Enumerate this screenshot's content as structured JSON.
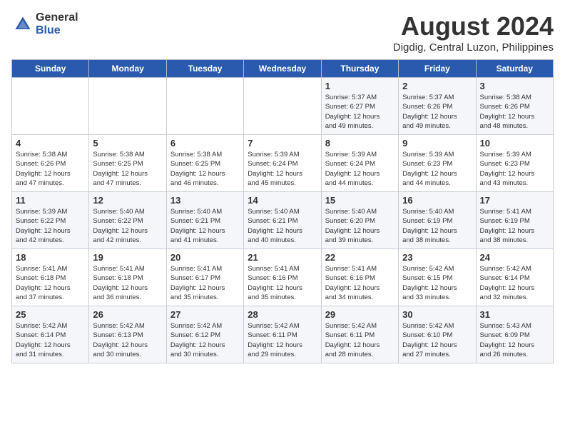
{
  "header": {
    "logo_general": "General",
    "logo_blue": "Blue",
    "month_year": "August 2024",
    "location": "Digdig, Central Luzon, Philippines"
  },
  "days_of_week": [
    "Sunday",
    "Monday",
    "Tuesday",
    "Wednesday",
    "Thursday",
    "Friday",
    "Saturday"
  ],
  "weeks": [
    [
      {
        "day": "",
        "info": ""
      },
      {
        "day": "",
        "info": ""
      },
      {
        "day": "",
        "info": ""
      },
      {
        "day": "",
        "info": ""
      },
      {
        "day": "1",
        "info": "Sunrise: 5:37 AM\nSunset: 6:27 PM\nDaylight: 12 hours\nand 49 minutes."
      },
      {
        "day": "2",
        "info": "Sunrise: 5:37 AM\nSunset: 6:26 PM\nDaylight: 12 hours\nand 49 minutes."
      },
      {
        "day": "3",
        "info": "Sunrise: 5:38 AM\nSunset: 6:26 PM\nDaylight: 12 hours\nand 48 minutes."
      }
    ],
    [
      {
        "day": "4",
        "info": "Sunrise: 5:38 AM\nSunset: 6:26 PM\nDaylight: 12 hours\nand 47 minutes."
      },
      {
        "day": "5",
        "info": "Sunrise: 5:38 AM\nSunset: 6:25 PM\nDaylight: 12 hours\nand 47 minutes."
      },
      {
        "day": "6",
        "info": "Sunrise: 5:38 AM\nSunset: 6:25 PM\nDaylight: 12 hours\nand 46 minutes."
      },
      {
        "day": "7",
        "info": "Sunrise: 5:39 AM\nSunset: 6:24 PM\nDaylight: 12 hours\nand 45 minutes."
      },
      {
        "day": "8",
        "info": "Sunrise: 5:39 AM\nSunset: 6:24 PM\nDaylight: 12 hours\nand 44 minutes."
      },
      {
        "day": "9",
        "info": "Sunrise: 5:39 AM\nSunset: 6:23 PM\nDaylight: 12 hours\nand 44 minutes."
      },
      {
        "day": "10",
        "info": "Sunrise: 5:39 AM\nSunset: 6:23 PM\nDaylight: 12 hours\nand 43 minutes."
      }
    ],
    [
      {
        "day": "11",
        "info": "Sunrise: 5:39 AM\nSunset: 6:22 PM\nDaylight: 12 hours\nand 42 minutes."
      },
      {
        "day": "12",
        "info": "Sunrise: 5:40 AM\nSunset: 6:22 PM\nDaylight: 12 hours\nand 42 minutes."
      },
      {
        "day": "13",
        "info": "Sunrise: 5:40 AM\nSunset: 6:21 PM\nDaylight: 12 hours\nand 41 minutes."
      },
      {
        "day": "14",
        "info": "Sunrise: 5:40 AM\nSunset: 6:21 PM\nDaylight: 12 hours\nand 40 minutes."
      },
      {
        "day": "15",
        "info": "Sunrise: 5:40 AM\nSunset: 6:20 PM\nDaylight: 12 hours\nand 39 minutes."
      },
      {
        "day": "16",
        "info": "Sunrise: 5:40 AM\nSunset: 6:19 PM\nDaylight: 12 hours\nand 38 minutes."
      },
      {
        "day": "17",
        "info": "Sunrise: 5:41 AM\nSunset: 6:19 PM\nDaylight: 12 hours\nand 38 minutes."
      }
    ],
    [
      {
        "day": "18",
        "info": "Sunrise: 5:41 AM\nSunset: 6:18 PM\nDaylight: 12 hours\nand 37 minutes."
      },
      {
        "day": "19",
        "info": "Sunrise: 5:41 AM\nSunset: 6:18 PM\nDaylight: 12 hours\nand 36 minutes."
      },
      {
        "day": "20",
        "info": "Sunrise: 5:41 AM\nSunset: 6:17 PM\nDaylight: 12 hours\nand 35 minutes."
      },
      {
        "day": "21",
        "info": "Sunrise: 5:41 AM\nSunset: 6:16 PM\nDaylight: 12 hours\nand 35 minutes."
      },
      {
        "day": "22",
        "info": "Sunrise: 5:41 AM\nSunset: 6:16 PM\nDaylight: 12 hours\nand 34 minutes."
      },
      {
        "day": "23",
        "info": "Sunrise: 5:42 AM\nSunset: 6:15 PM\nDaylight: 12 hours\nand 33 minutes."
      },
      {
        "day": "24",
        "info": "Sunrise: 5:42 AM\nSunset: 6:14 PM\nDaylight: 12 hours\nand 32 minutes."
      }
    ],
    [
      {
        "day": "25",
        "info": "Sunrise: 5:42 AM\nSunset: 6:14 PM\nDaylight: 12 hours\nand 31 minutes."
      },
      {
        "day": "26",
        "info": "Sunrise: 5:42 AM\nSunset: 6:13 PM\nDaylight: 12 hours\nand 30 minutes."
      },
      {
        "day": "27",
        "info": "Sunrise: 5:42 AM\nSunset: 6:12 PM\nDaylight: 12 hours\nand 30 minutes."
      },
      {
        "day": "28",
        "info": "Sunrise: 5:42 AM\nSunset: 6:11 PM\nDaylight: 12 hours\nand 29 minutes."
      },
      {
        "day": "29",
        "info": "Sunrise: 5:42 AM\nSunset: 6:11 PM\nDaylight: 12 hours\nand 28 minutes."
      },
      {
        "day": "30",
        "info": "Sunrise: 5:42 AM\nSunset: 6:10 PM\nDaylight: 12 hours\nand 27 minutes."
      },
      {
        "day": "31",
        "info": "Sunrise: 5:43 AM\nSunset: 6:09 PM\nDaylight: 12 hours\nand 26 minutes."
      }
    ]
  ]
}
